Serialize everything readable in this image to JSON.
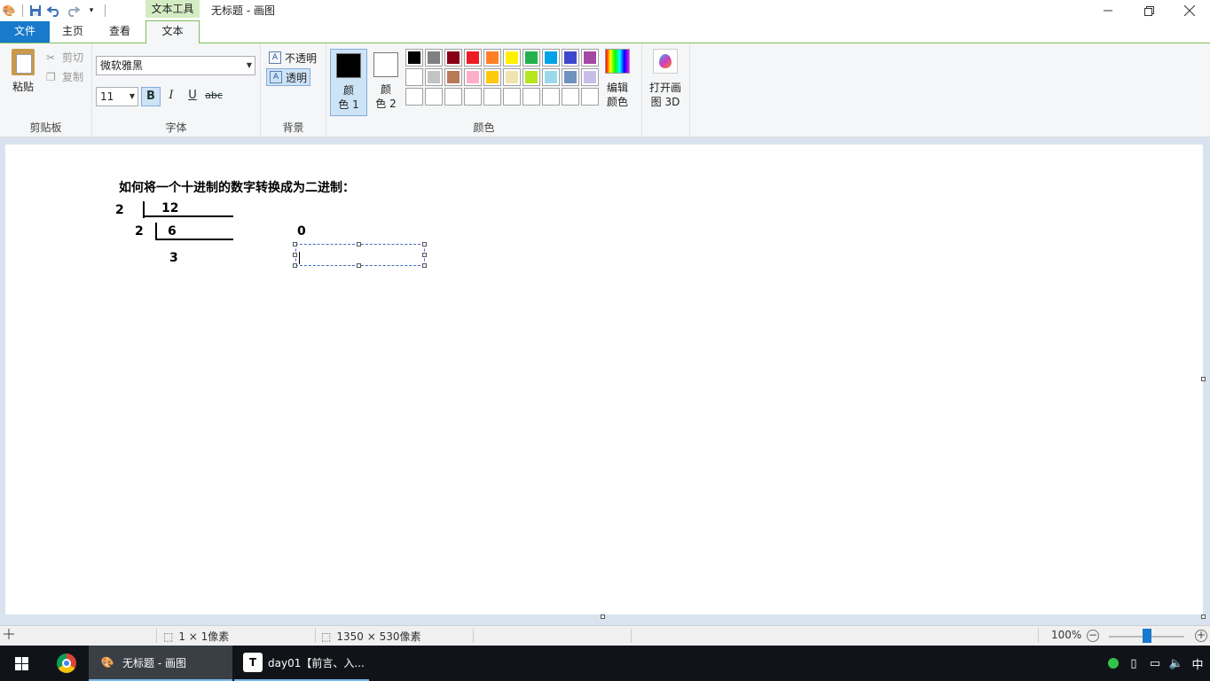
{
  "window": {
    "title": "无标题 - 画图",
    "context_tab_group": "文本工具"
  },
  "tabs": {
    "file": "文件",
    "home": "主页",
    "view": "查看",
    "text": "文本"
  },
  "clipboard": {
    "paste": "粘贴",
    "cut": "剪切",
    "copy": "复制",
    "label": "剪贴板"
  },
  "font": {
    "family": "微软雅黑",
    "size": "11",
    "bold": "B",
    "italic": "I",
    "underline": "U",
    "strike": "abc",
    "label": "字体"
  },
  "background": {
    "opaque": "不透明",
    "transparent": "透明",
    "label": "背景"
  },
  "colors": {
    "color1": "颜色 1",
    "color1_line1": "颜",
    "color1_line2": "色 1",
    "color2_line1": "颜",
    "color2_line2": "色 2",
    "color1_value": "#000000",
    "color2_value": "#ffffff",
    "edit_line1": "编辑",
    "edit_line2": "颜色",
    "label": "颜色",
    "palette": [
      "#000000",
      "#7f7f7f",
      "#880015",
      "#ed1c24",
      "#ff7f27",
      "#fff200",
      "#22b14c",
      "#00a2e8",
      "#3f48cc",
      "#a349a4",
      "#ffffff",
      "#c3c3c3",
      "#b97a57",
      "#ffaec9",
      "#ffc90e",
      "#efe4b0",
      "#b5e61d",
      "#99d9ea",
      "#7092be",
      "#c8bfe7",
      "",
      "",
      "",
      "",
      "",
      "",
      "",
      "",
      "",
      ""
    ]
  },
  "paint3d": {
    "line1": "打开画",
    "line2": "图 3D"
  },
  "canvas": {
    "heading": "如何将一个十进制的数字转换成为二进制：",
    "divisor1": "2",
    "dividend1": "12",
    "divisor2": "2",
    "dividend2": "6",
    "quotient": "3",
    "remainder": "0"
  },
  "status": {
    "selection_size": "1 × 1像素",
    "canvas_size": "1350 × 530像素",
    "zoom": "100%"
  },
  "taskbar": {
    "paint_app": "无标题 - 画图",
    "typora_app": "day01【前言、入..."
  },
  "tray": {
    "ime": "中"
  }
}
